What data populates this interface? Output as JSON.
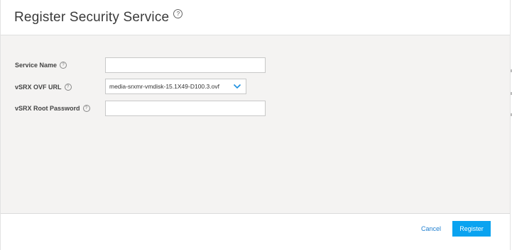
{
  "dialog": {
    "title": "Register Security Service",
    "help_glyph": "?"
  },
  "form": {
    "service_name": {
      "label": "Service Name",
      "value": ""
    },
    "ovf_url": {
      "label": "vSRX OVF URL",
      "selected": "media-srxmr-vmdisk-15.1X49-D100.3.ovf"
    },
    "root_password": {
      "label": "vSRX Root Password",
      "value": ""
    }
  },
  "footer": {
    "cancel_label": "Cancel",
    "register_label": "Register"
  },
  "colors": {
    "accent": "#0aa3f0",
    "link": "#1f7fd0",
    "body_bg": "#f4f3f2"
  },
  "icons": {
    "help": "question-circle-icon",
    "dropdown": "chevron-down-icon"
  }
}
